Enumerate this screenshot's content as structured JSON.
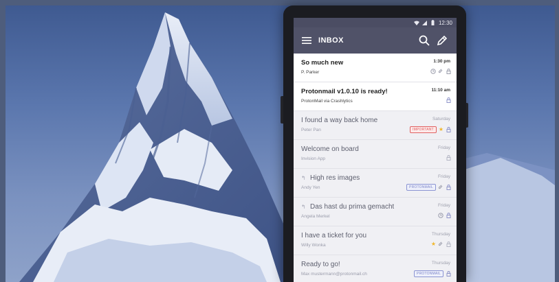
{
  "statusbar": {
    "time": "12:30"
  },
  "appbar": {
    "title": "INBOX"
  },
  "emails": [
    {
      "subject": "So much new",
      "sender": "P. Parker",
      "date": "1:30 pm",
      "unread": true
    },
    {
      "subject": "Protonmail v1.0.10 is ready!",
      "sender": "ProtonMail via Crashlytics",
      "date": "11:10 am",
      "unread": true
    },
    {
      "subject": "I found a way back home",
      "sender": "Peter Pan",
      "date": "Saturday",
      "unread": false,
      "label": "IMPORTANT"
    },
    {
      "subject": "Welcome on board",
      "sender": "Invision App",
      "date": "Friday",
      "unread": false
    },
    {
      "subject": "High res images",
      "sender": "Andy Yen",
      "date": "Friday",
      "unread": false,
      "label": "PROTONMAIL"
    },
    {
      "subject": "Das hast du prima gemacht",
      "sender": "Angela Merkel",
      "date": "Friday",
      "unread": false
    },
    {
      "subject": "I have a ticket for you",
      "sender": "Willy Wonka",
      "date": "Thursday",
      "unread": false
    },
    {
      "subject": "Ready to go!",
      "sender": "Max mustermann@protonmail.ch",
      "date": "Thursday",
      "unread": false,
      "label": "PROTONMAIL"
    }
  ],
  "colors": {
    "appbar": "#505268",
    "statusbar": "#4b4d63",
    "important": "#e06060",
    "protonmail_label": "#7b84c9",
    "star": "#f0b62b"
  },
  "icons": [
    "menu-icon",
    "search-icon",
    "compose-icon",
    "reply-icon",
    "clock-icon",
    "paperclip-icon",
    "lock-icon",
    "star-icon",
    "wifi-icon",
    "signal-icon",
    "battery-icon"
  ]
}
